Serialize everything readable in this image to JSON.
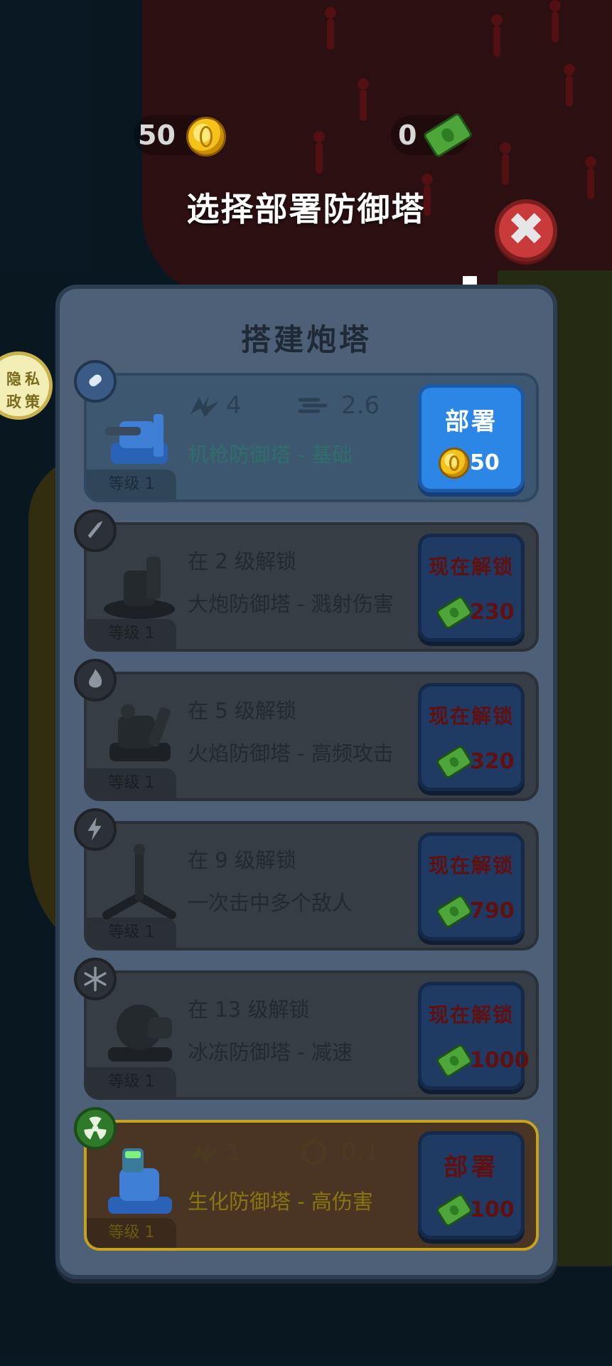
{
  "hud": {
    "coins": "50",
    "cash": "0"
  },
  "title": "选择部署防御塔",
  "privacy": {
    "line1": "隐私",
    "line2": "政策"
  },
  "panel": {
    "title": "搭建炮塔",
    "towers": [
      {
        "icon": "bullet-icon",
        "level": "等级 1",
        "damage": "4",
        "speed": "2.6",
        "name": "机枪防御塔 - 基础",
        "action": "部署",
        "price": "50",
        "currency": "coin"
      },
      {
        "icon": "rocket-icon",
        "level": "等级 1",
        "unlock": "在 2 级解锁",
        "name": "大炮防御塔 - 溅射伤害",
        "action": "现在解锁",
        "price": "230",
        "currency": "cash"
      },
      {
        "icon": "flame-icon",
        "level": "等级 1",
        "unlock": "在 5 级解锁",
        "name": "火焰防御塔 - 高频攻击",
        "action": "现在解锁",
        "price": "320",
        "currency": "cash"
      },
      {
        "icon": "lightning-icon",
        "level": "等级 1",
        "unlock": "在 9 级解锁",
        "name": "一次击中多个敌人",
        "action": "现在解锁",
        "price": "790",
        "currency": "cash"
      },
      {
        "icon": "snowflake-icon",
        "level": "等级 1",
        "unlock": "在 13 级解锁",
        "name": "冰冻防御塔 - 减速",
        "action": "现在解锁",
        "price": "1000",
        "currency": "cash"
      },
      {
        "icon": "radiation-icon",
        "level": "等级 1",
        "damage": "1",
        "speed": "0.1",
        "name": "生化防御塔 - 高伤害",
        "action": "部署",
        "price": "100",
        "currency": "cash"
      }
    ]
  },
  "colors": {
    "panel": "#4d6077",
    "deploy_blue": "#2b86e6",
    "locked_card": "#363d44",
    "bio_border": "#c7a21c",
    "unlock_text": "#611010"
  }
}
